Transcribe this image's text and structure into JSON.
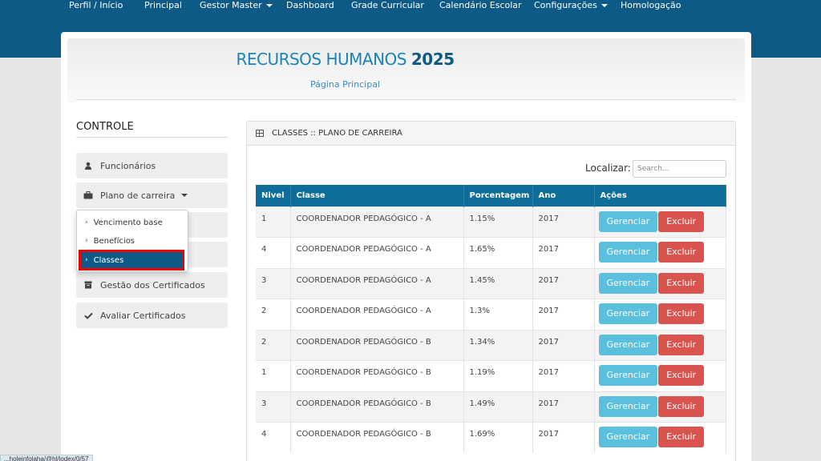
{
  "nav": {
    "items": [
      "Perfil / Início",
      "Principal",
      "Gestor Master",
      "Dashboard",
      "Grade Curricular",
      "Calendário Escolar",
      "Configurações",
      "Homologação"
    ]
  },
  "header": {
    "title_main": "RECURSOS HUMANOS ",
    "title_year": "2025",
    "subtitle": "Página Principal"
  },
  "sidebar": {
    "heading": "CONTROLE",
    "items": [
      {
        "label": "Funcionários",
        "icon": "user-icon"
      },
      {
        "label": "Plano de carreira",
        "icon": "briefcase-icon"
      },
      {
        "label": "Gestão dos Certificados",
        "icon": "archive-icon"
      },
      {
        "label": "Avaliar Certificados",
        "icon": "check-icon"
      }
    ],
    "dropdown": [
      "Vencimento base",
      "Benefícios",
      "Classes"
    ]
  },
  "card": {
    "title": "CLASSES :: PLANO DE CARREIRA",
    "search_label": "Localizar:",
    "search_placeholder": "Search..."
  },
  "table": {
    "headers": [
      "Nivel",
      "Classe",
      "Porcentagem",
      "Ano",
      "Ações"
    ],
    "rows": [
      {
        "nivel": "1",
        "classe": "COORDENADOR PEDAGÓGICO - A",
        "pct": "1.15%",
        "ano": "2017"
      },
      {
        "nivel": "4",
        "classe": "COORDENADOR PEDAGÓGICO - A",
        "pct": "1.65%",
        "ano": "2017"
      },
      {
        "nivel": "3",
        "classe": "COORDENADOR PEDAGÓGICO - A",
        "pct": "1.45%",
        "ano": "2017"
      },
      {
        "nivel": "2",
        "classe": "COORDENADOR PEDAGÓGICO - A",
        "pct": "1.3%",
        "ano": "2017"
      },
      {
        "nivel": "2",
        "classe": "COORDENADOR PEDAGÓGICO - B",
        "pct": "1.34%",
        "ano": "2017"
      },
      {
        "nivel": "1",
        "classe": "COORDENADOR PEDAGÓGICO - B",
        "pct": "1.19%",
        "ano": "2017"
      },
      {
        "nivel": "3",
        "classe": "COORDENADOR PEDAGÓGICO - B",
        "pct": "1.49%",
        "ano": "2017"
      },
      {
        "nivel": "4",
        "classe": "COORDENADOR PEDAGÓGICO - B",
        "pct": "1.69%",
        "ano": "2017"
      }
    ],
    "btn_manage": "Gerenciar",
    "btn_delete": "Excluir"
  },
  "statusbar": "...holeinfolaha/@hl/lodex/0/57",
  "colors": {
    "topbar": "#0e5a86",
    "table_header": "#0e6e99",
    "manage": "#5bc0de",
    "delete": "#d9534f"
  }
}
